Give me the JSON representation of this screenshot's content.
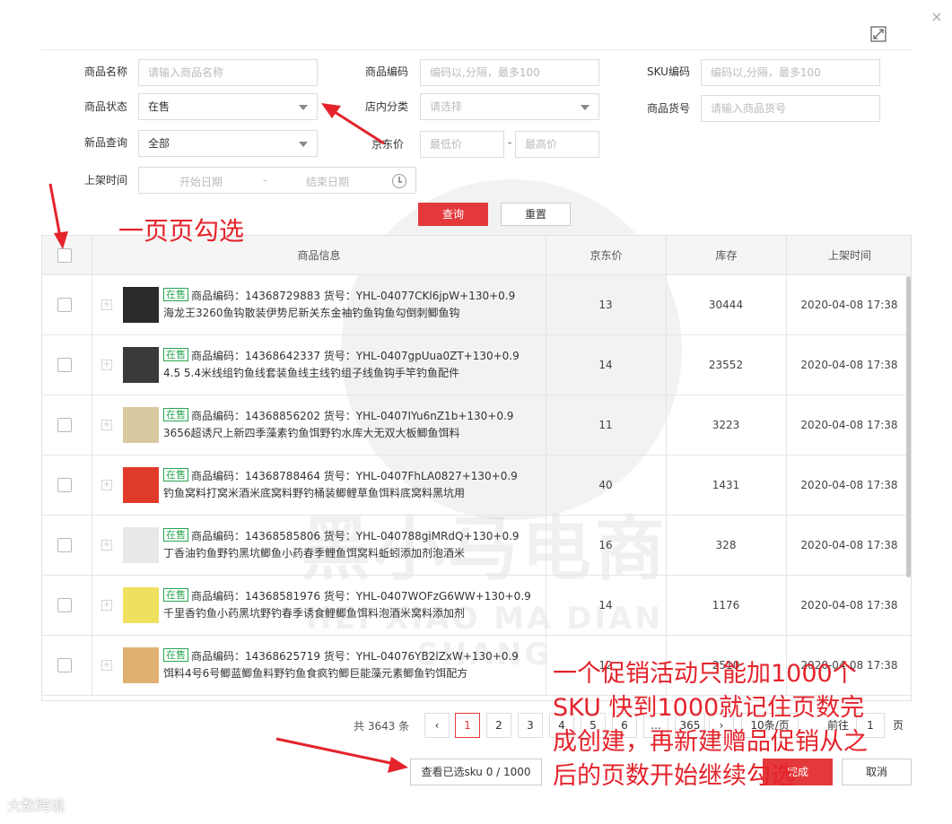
{
  "dialog": {
    "close_symbol": "×",
    "expand_icon": "expand-icon"
  },
  "filters": {
    "product_name_label": "商品名称",
    "product_name_placeholder": "请输入商品名称",
    "product_code_label": "商品编码",
    "product_code_placeholder": "编码以,分隔，最多100",
    "sku_code_label": "SKU编码",
    "sku_code_placeholder": "编码以,分隔，最多100",
    "status_label": "商品状态",
    "status_value": "在售",
    "shop_category_label": "店内分类",
    "shop_category_placeholder": "请选择",
    "item_no_label": "商品货号",
    "item_no_placeholder": "请输入商品货号",
    "new_query_label": "新品查询",
    "new_query_value": "全部",
    "jd_price_label": "京东价",
    "min_price_placeholder": "最低价",
    "price_dash": "-",
    "max_price_placeholder": "最高价",
    "listing_time_label": "上架时间",
    "start_date_placeholder": "开始日期",
    "date_dash": "-",
    "end_date_placeholder": "结束日期",
    "query_button": "查询",
    "reset_button": "重置"
  },
  "table": {
    "headers": [
      "商品信息",
      "京东价",
      "库存",
      "上架时间"
    ],
    "rows": [
      {
        "status": "在售",
        "meta": "商品编码：14368729883  货号：YHL-04077CKl6jpW+130+0.9",
        "title": "海龙王3260鱼钩散装伊势尼新关东金袖钓鱼钩鱼勾倒刺鲫鱼钩",
        "price": "13",
        "stock": "30444",
        "time": "2020-04-08 17:38"
      },
      {
        "status": "在售",
        "meta": "商品编码：14368642337  货号：YHL-0407gpUua0ZT+130+0.9",
        "title": "4.5 5.4米线组钓鱼线套装鱼线主线钓组子线鱼钩手竿钓鱼配件",
        "price": "14",
        "stock": "23552",
        "time": "2020-04-08 17:38"
      },
      {
        "status": "在售",
        "meta": "商品编码：14368856202  货号：YHL-0407IYu6nZ1b+130+0.9",
        "title": "3656超诱尺上新四季藻素钓鱼饵野钓水库大无双大板鲫鱼饵料",
        "price": "11",
        "stock": "3223",
        "time": "2020-04-08 17:38"
      },
      {
        "status": "在售",
        "meta": "商品编码：14368788464  货号：YHL-0407FhLA0827+130+0.9",
        "title": "钓鱼窝料打窝米酒米底窝料野钓桶装鲫鲤草鱼饵料底窝料黑坑用",
        "price": "40",
        "stock": "1431",
        "time": "2020-04-08 17:38"
      },
      {
        "status": "在售",
        "meta": "商品编码：14368585806  货号：YHL-040788giMRdQ+130+0.9",
        "title": "丁香油钓鱼野钓黑坑鲫鱼小药春季鲤鱼饵窝料蚯蚓添加剂泡酒米",
        "price": "16",
        "stock": "328",
        "time": "2020-04-08 17:38"
      },
      {
        "status": "在售",
        "meta": "商品编码：14368581976  货号：YHL-0407WOFzG6WW+130+0.9",
        "title": "千里香钓鱼小药黑坑野钓春季诱食鲤鲫鱼饵料泡酒米窝料添加剂",
        "price": "14",
        "stock": "1176",
        "time": "2020-04-08 17:38"
      },
      {
        "status": "在售",
        "meta": "商品编码：14368625719  货号：YHL-04076YB2lZxW+130+0.9",
        "title": "饵料4号6号鲫蓝鲫鱼料野钓鱼食疯钓鲫巨能藻元素鲫鱼钓饵配方",
        "price": "12",
        "stock": "2510",
        "time": "2020-04-08 17:38"
      }
    ]
  },
  "pagination": {
    "total": "共 3643 条",
    "prev": "‹",
    "pages": [
      "1",
      "2",
      "3",
      "4",
      "5",
      "6",
      "...",
      "365"
    ],
    "next": "›",
    "page_size": "10条/页",
    "goto_label": "前往",
    "goto_value": "1",
    "page_suffix": "页"
  },
  "footer": {
    "view_selected": "查看已选sku 0 / 1000",
    "done_button": "完成",
    "cancel_button": "取消"
  },
  "annotations": {
    "select_per_page": "一页页勾选",
    "note_line1": "一个促销活动只能加1000个",
    "note_line2": "SKU 快到1000就记住页数完",
    "note_line3": "成创建，再新建赠品促销从之",
    "note_line4": "后的页数开始继续勾选"
  },
  "watermark": {
    "text_cn": "黑小马电商",
    "text_en": "HEI XIAO MA DIAN SHANG"
  },
  "corner_logo": "大数跨境",
  "colors": {
    "accent": "#e4393c",
    "badge_green": "#2aa44f",
    "annotation_red": "#e4232b"
  }
}
